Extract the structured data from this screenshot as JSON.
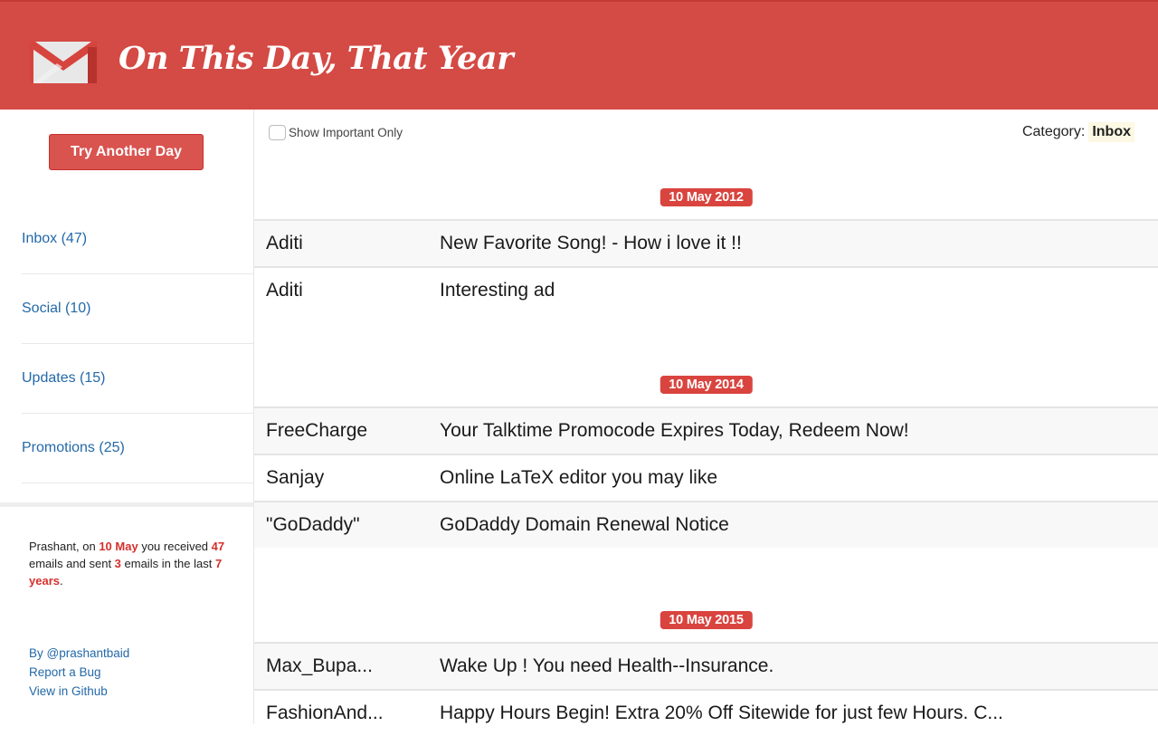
{
  "header": {
    "title": "On This Day, That Year",
    "logo_icon": "gmail-envelope-icon",
    "colors": {
      "header_bg": "#d44a44",
      "accent_red": "#d9443f",
      "link_blue": "#2369a8"
    }
  },
  "sidebar": {
    "try_button_label": "Try Another Day",
    "nav": [
      {
        "label": "Inbox (47)"
      },
      {
        "label": "Social (10)"
      },
      {
        "label": "Updates (15)"
      },
      {
        "label": "Promotions (25)"
      }
    ],
    "summary": {
      "name_prefix": "Prashant, on ",
      "date": "10 May",
      "after_date": " you received ",
      "received": "47",
      "after_received": " emails and sent ",
      "sent": "3",
      "after_sent": " emails in the last ",
      "years": "7 years",
      "end": "."
    },
    "links": [
      {
        "label": "By @prashantbaid"
      },
      {
        "label": "Report a Bug"
      },
      {
        "label": "View in Github"
      }
    ]
  },
  "main": {
    "important_label": "Show Important Only",
    "important_checked": false,
    "category_label": "Category:",
    "category_value": "Inbox",
    "groups": [
      {
        "date": "10 May 2012",
        "emails": [
          {
            "sender": "Aditi",
            "subject": "New Favorite Song! - How i love it !!"
          },
          {
            "sender": "Aditi",
            "subject": "Interesting ad"
          }
        ]
      },
      {
        "date": "10 May 2014",
        "emails": [
          {
            "sender": "FreeCharge",
            "subject": "Your Talktime Promocode Expires Today, Redeem Now!"
          },
          {
            "sender": "Sanjay",
            "subject": "Online LaTeX editor you may like"
          },
          {
            "sender": "\"GoDaddy\"",
            "subject": "GoDaddy Domain Renewal Notice"
          }
        ]
      },
      {
        "date": "10 May 2015",
        "emails": [
          {
            "sender": "Max_Bupa...",
            "subject": "Wake Up ! You need Health--Insurance."
          },
          {
            "sender": "FashionAnd...",
            "subject": "Happy Hours Begin! Extra 20% Off Sitewide for just few Hours. C..."
          }
        ]
      }
    ]
  }
}
